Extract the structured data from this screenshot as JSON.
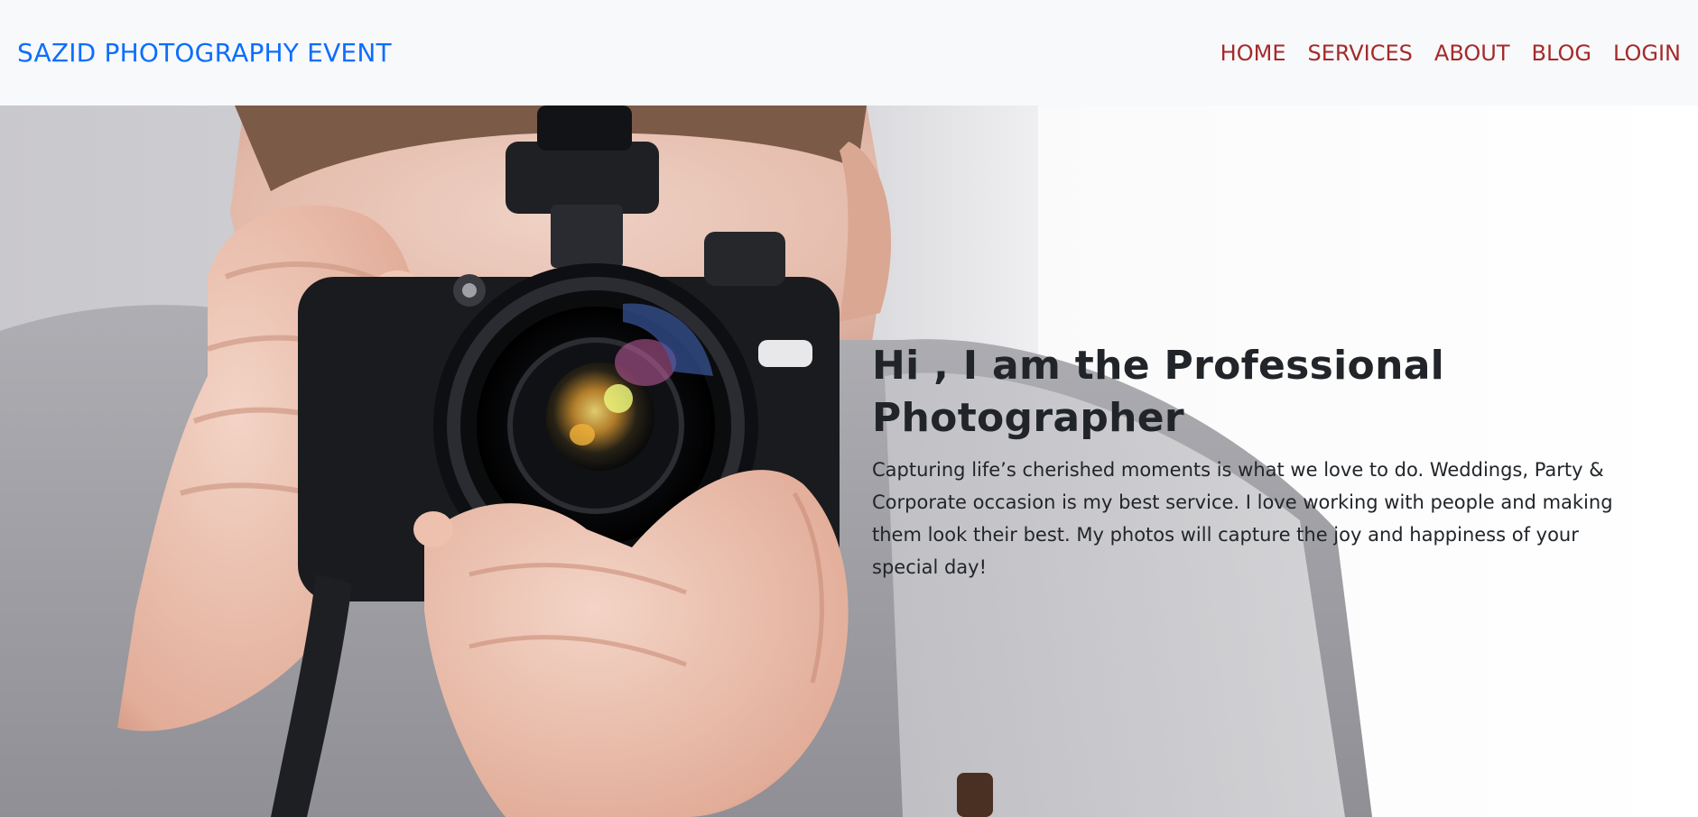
{
  "navbar": {
    "brand": "SAZID PHOTOGRAPHY EVENT",
    "links": [
      "HOME",
      "SERVICES",
      "ABOUT",
      "BLOG",
      "LOGIN"
    ]
  },
  "hero": {
    "title": "Hi , I am the Professional Photographer",
    "description": "Capturing life’s cherished moments is what we love to do. Weddings, Party & Corporate occasion is my best service. I love working with people and making them look their best. My photos will capture the joy and happiness of your special day!"
  },
  "colors": {
    "brand": "#0d6efd",
    "nav_link": "#a52a2a",
    "navbar_bg": "#f8f9fa",
    "text": "#212529"
  }
}
